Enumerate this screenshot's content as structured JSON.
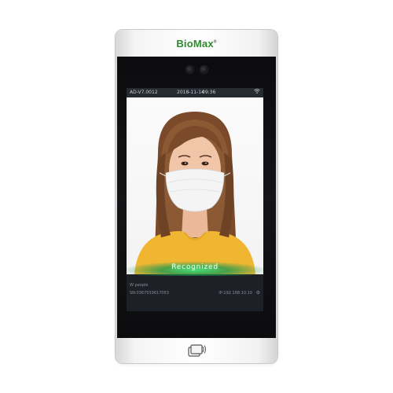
{
  "device": {
    "brand": "BioMax",
    "brand_mark": "®"
  },
  "status_bar": {
    "version": "AD-V7.0012",
    "date": "2018-11-14",
    "time": "09:36",
    "wifi_icon": "wifi-icon"
  },
  "screen": {
    "recognized_label": "Recognized",
    "person_count": "W people",
    "serial": "SN:0367033617053",
    "ip": "IP:192.168.10.10",
    "settings_icon": "gear-icon"
  },
  "icons": {
    "nfc": "nfc-card-icon"
  },
  "colors": {
    "brand_green": "#2d8a2d",
    "recognized_glow": "#3cdc78"
  }
}
